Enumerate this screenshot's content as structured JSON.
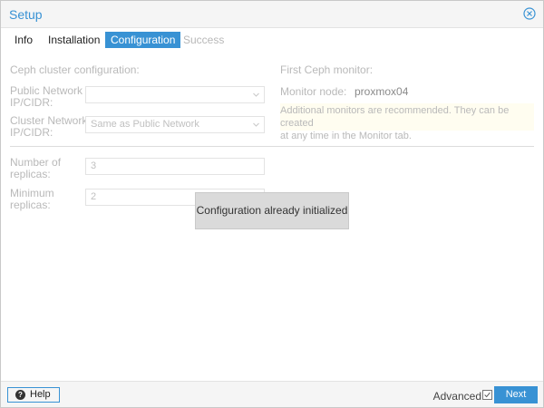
{
  "window": {
    "title": "Setup"
  },
  "tabs": [
    {
      "label": "Info",
      "state": "normal"
    },
    {
      "label": "Installation",
      "state": "normal"
    },
    {
      "label": "Configuration",
      "state": "active"
    },
    {
      "label": "Success",
      "state": "disabled"
    }
  ],
  "ceph": {
    "section_title": "Ceph cluster configuration:",
    "public_network_label_1": "Public Network",
    "public_network_label_2": "IP/CIDR:",
    "public_network_value": "",
    "cluster_network_label_1": "Cluster Network",
    "cluster_network_label_2": "IP/CIDR:",
    "cluster_network_value": "Same as Public Network",
    "replicas_label_1": "Number of",
    "replicas_label_2": "replicas:",
    "replicas_value": "3",
    "min_replicas_label_1": "Minimum",
    "min_replicas_label_2": "replicas:",
    "min_replicas_value": "2"
  },
  "monitor": {
    "section_title": "First Ceph monitor:",
    "node_label": "Monitor node:",
    "node_value": "proxmox04",
    "note_line_1": "Additional monitors are recommended. They can be created",
    "note_line_2": "at any time in the Monitor tab."
  },
  "toast": {
    "message": "Configuration already initialized"
  },
  "footer": {
    "help_label": "Help",
    "advanced_label": "Advanced",
    "advanced_checked": true,
    "next_label": "Next"
  },
  "colors": {
    "accent": "#3892d4",
    "disabled_text": "#b9b9b9",
    "note_bg": "#fffdf0"
  }
}
